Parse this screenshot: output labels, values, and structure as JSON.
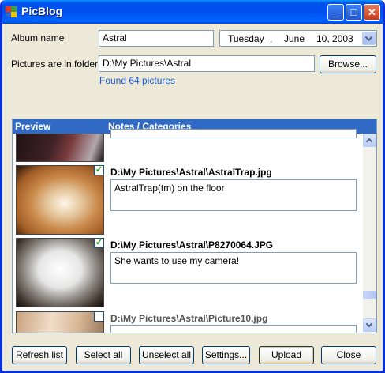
{
  "window": {
    "title": "PicBlog",
    "min_label": "_",
    "max_label": "□",
    "close_label": "✕"
  },
  "album": {
    "label": "Album name",
    "value": "Astral"
  },
  "date": {
    "weekday": "Tuesday",
    "sep": ",",
    "month": "June",
    "day_year": "10, 2003"
  },
  "folder": {
    "label": "Pictures are in folder",
    "value": "D:\\My Pictures\\Astral",
    "browse_label": "Browse...",
    "found_text": "Found 64 pictures"
  },
  "list": {
    "headers": {
      "preview": "Preview",
      "notes": "Notes / Categories"
    },
    "items": [
      {
        "filename": "",
        "note": "",
        "checked": true
      },
      {
        "filename": "D:\\My Pictures\\Astral\\AstralTrap.jpg",
        "note": "AstralTrap(tm) on the floor",
        "checked": true,
        "check_mark": "✓"
      },
      {
        "filename": "D:\\My Pictures\\Astral\\P8270064.JPG",
        "note": "She wants to use my camera!",
        "checked": true,
        "check_mark": "✓"
      },
      {
        "filename": "D:\\My Pictures\\Astral\\Picture10.jpg",
        "note": "",
        "checked": false
      }
    ]
  },
  "buttons": {
    "refresh": "Refresh list",
    "select_all": "Select all",
    "unselect_all": "Unselect all",
    "settings": "Settings...",
    "upload": "Upload",
    "close": "Close"
  },
  "colors": {
    "titlebar": "#0053ee",
    "header": "#316ac5",
    "link": "#1c5bd2",
    "face": "#ece9d8"
  }
}
